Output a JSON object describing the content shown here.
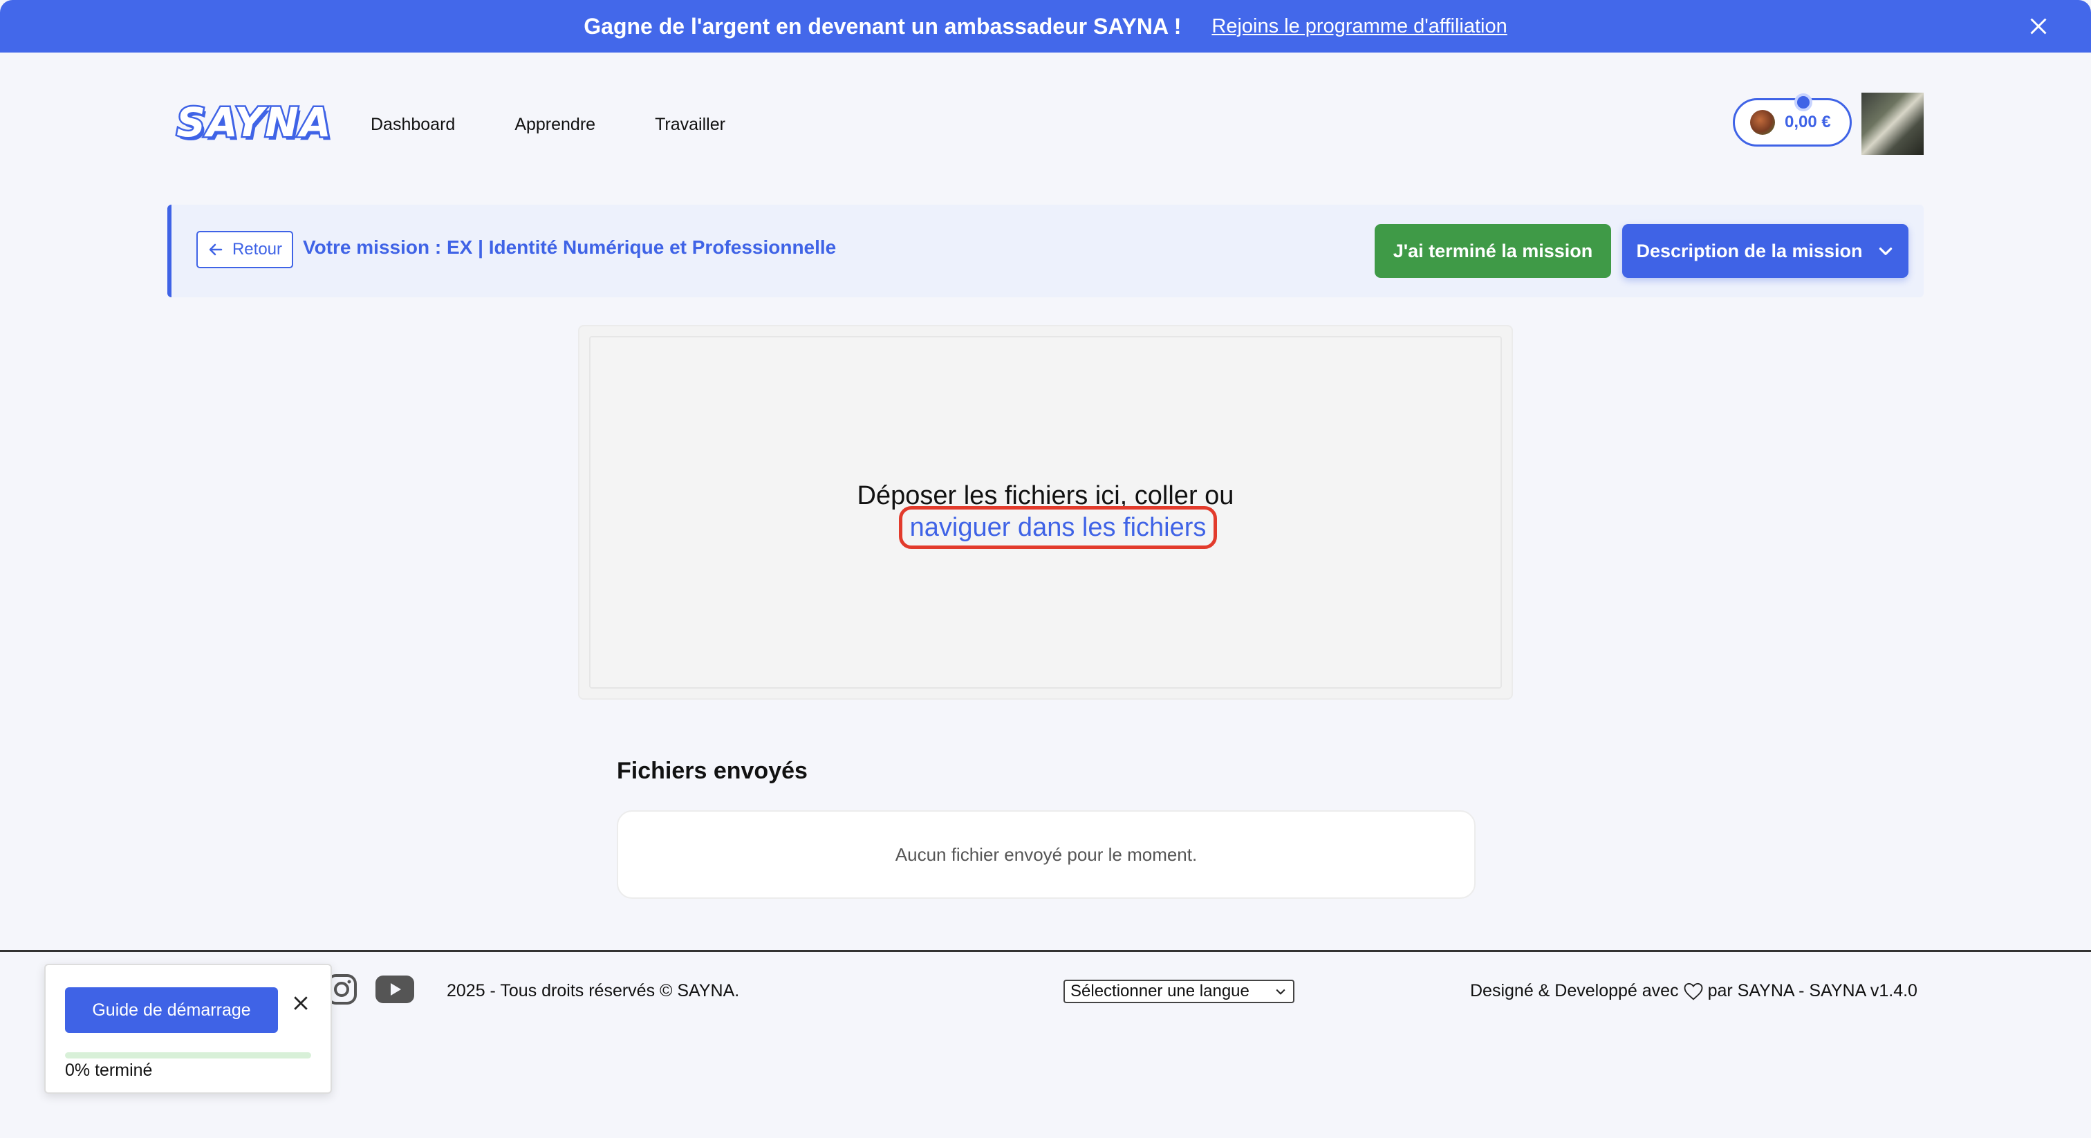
{
  "banner": {
    "text": "Gagne de l'argent en devenant un ambassadeur SAYNA !",
    "link": "Rejoins le programme d'affiliation",
    "close_icon": "close-icon"
  },
  "header": {
    "logo": "SAYNA",
    "nav": [
      "Dashboard",
      "Apprendre",
      "Travailler"
    ],
    "wallet_amount": "0,00 €",
    "wallet_icon": "coin-icon"
  },
  "mission": {
    "back_label": "Retour",
    "title": "Votre mission : EX | Identité Numérique et Professionnelle",
    "done_label": "J'ai terminé la mission",
    "description_label": "Description de la mission"
  },
  "dropzone": {
    "text": "Déposer les fichiers ici, coller ou",
    "browse_label": "naviguer dans les fichiers"
  },
  "sent_files": {
    "title": "Fichiers envoyés",
    "empty": "Aucun fichier envoyé pour le moment."
  },
  "footer": {
    "copyright": "2025 - Tous droits réservés © SAYNA.",
    "language_select": "Sélectionner une langue",
    "credits_before": "Designé & Developpé avec",
    "credits_after": "par SAYNA - SAYNA v1.4.0"
  },
  "guide": {
    "button_label": "Guide de démarrage",
    "progress_percent": 0,
    "status": "0% terminé"
  },
  "colors": {
    "primary": "#3f63e6",
    "success": "#3f9a47",
    "highlight": "#e23b2c"
  }
}
